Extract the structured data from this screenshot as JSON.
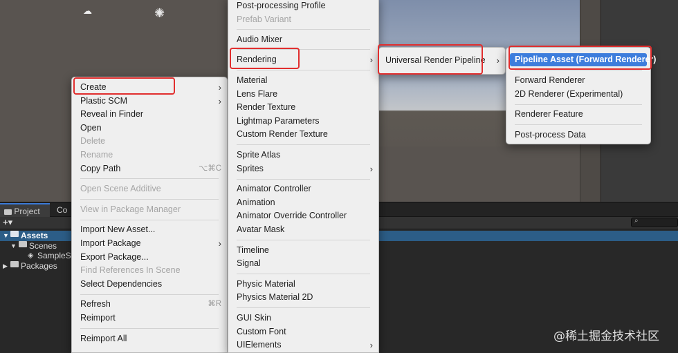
{
  "project": {
    "tabs": [
      "Project",
      "Co"
    ],
    "tree": [
      {
        "label": "Assets",
        "selected": true
      },
      {
        "label": "Scenes"
      },
      {
        "label": "SampleSc"
      },
      {
        "label": "Packages"
      }
    ]
  },
  "context_menu": {
    "items": [
      {
        "label": "Create",
        "submenu": true
      },
      {
        "label": "Plastic SCM",
        "submenu": true
      },
      {
        "label": "Reveal in Finder"
      },
      {
        "label": "Open"
      },
      {
        "label": "Delete",
        "disabled": true
      },
      {
        "label": "Rename",
        "disabled": true
      },
      {
        "label": "Copy Path",
        "shortcut": "⌥⌘C"
      },
      {
        "label": "Open Scene Additive",
        "disabled": true
      },
      {
        "label": "View in Package Manager",
        "disabled": true
      },
      {
        "label": "Import New Asset..."
      },
      {
        "label": "Import Package",
        "submenu": true
      },
      {
        "label": "Export Package..."
      },
      {
        "label": "Find References In Scene",
        "disabled": true
      },
      {
        "label": "Select Dependencies"
      },
      {
        "label": "Refresh",
        "shortcut": "⌘R"
      },
      {
        "label": "Reimport"
      },
      {
        "label": "Reimport All"
      }
    ]
  },
  "create_menu": {
    "items": [
      {
        "label": "Post-processing Profile"
      },
      {
        "label": "Prefab Variant",
        "disabled": true
      },
      {
        "label": "Audio Mixer"
      },
      {
        "label": "Rendering",
        "submenu": true
      },
      {
        "label": "Material"
      },
      {
        "label": "Lens Flare"
      },
      {
        "label": "Render Texture"
      },
      {
        "label": "Lightmap Parameters"
      },
      {
        "label": "Custom Render Texture"
      },
      {
        "label": "Sprite Atlas"
      },
      {
        "label": "Sprites",
        "submenu": true
      },
      {
        "label": "Animator Controller"
      },
      {
        "label": "Animation"
      },
      {
        "label": "Animator Override Controller"
      },
      {
        "label": "Avatar Mask"
      },
      {
        "label": "Timeline"
      },
      {
        "label": "Signal"
      },
      {
        "label": "Physic Material"
      },
      {
        "label": "Physics Material 2D"
      },
      {
        "label": "GUI Skin"
      },
      {
        "label": "Custom Font"
      },
      {
        "label": "UIElements",
        "submenu": true
      }
    ]
  },
  "rendering_menu": {
    "items": [
      {
        "label": "Universal Render Pipeline",
        "submenu": true
      }
    ]
  },
  "urp_menu": {
    "items": [
      {
        "label": "Pipeline Asset (Forward Renderer)",
        "selected": true
      },
      {
        "label": "Forward Renderer"
      },
      {
        "label": "2D Renderer (Experimental)"
      },
      {
        "label": "Renderer Feature"
      },
      {
        "label": "Post-process Data"
      }
    ]
  },
  "icons": {
    "submenu_arrow": "›",
    "add": "+▾",
    "search": "⌕",
    "cloud": "☁",
    "sun": "✺",
    "expanded": "▼",
    "collapsed": "▶",
    "scene": "◈"
  },
  "watermark": "@稀土掘金技术社区",
  "colors": {
    "highlight_box": "#e12e2e",
    "selection": "#3d7ddc",
    "tree_selection": "#2c5d87"
  }
}
